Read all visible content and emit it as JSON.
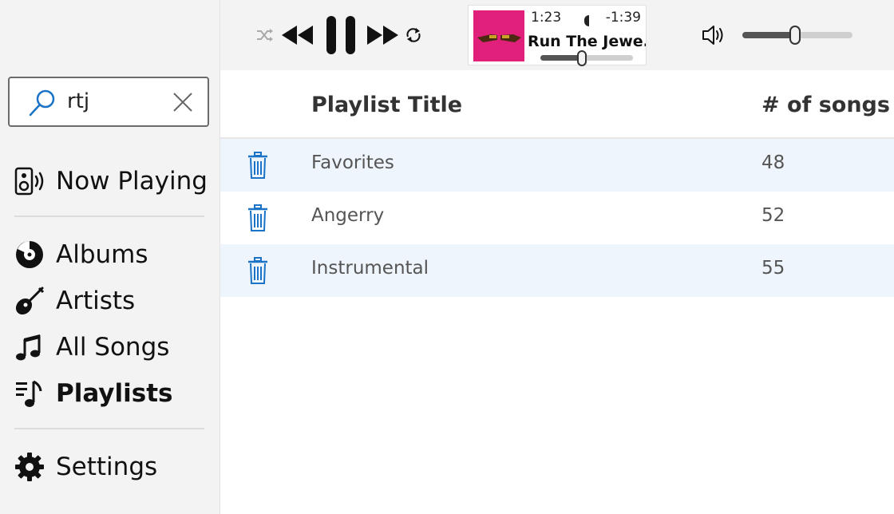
{
  "search": {
    "value": "rtj",
    "icon": "search-icon",
    "clear_icon": "close-icon"
  },
  "nav": {
    "now_playing": "Now Playing",
    "albums": "Albums",
    "artists": "Artists",
    "all_songs": "All Songs",
    "playlists": "Playlists",
    "settings": "Settings",
    "active": "playlists"
  },
  "transport": {
    "icons": [
      "shuffle-icon",
      "previous-icon",
      "pause-icon",
      "next-icon",
      "repeat-icon"
    ]
  },
  "now_playing": {
    "elapsed": "1:23",
    "remaining": "-1:39",
    "title": "Run The Jewe...",
    "progress": 0.45,
    "album_color": "#e0207a"
  },
  "volume": {
    "level": 0.48
  },
  "table": {
    "col_title": "Playlist Title",
    "col_count": "# of songs",
    "rows": [
      {
        "title": "Favorites",
        "count": "48"
      },
      {
        "title": "Angerry",
        "count": "52"
      },
      {
        "title": "Instrumental",
        "count": "55"
      }
    ]
  },
  "colors": {
    "accent": "#1a73c6",
    "row_alt": "#eef5fc",
    "sidebar": "#f3f3f3"
  }
}
